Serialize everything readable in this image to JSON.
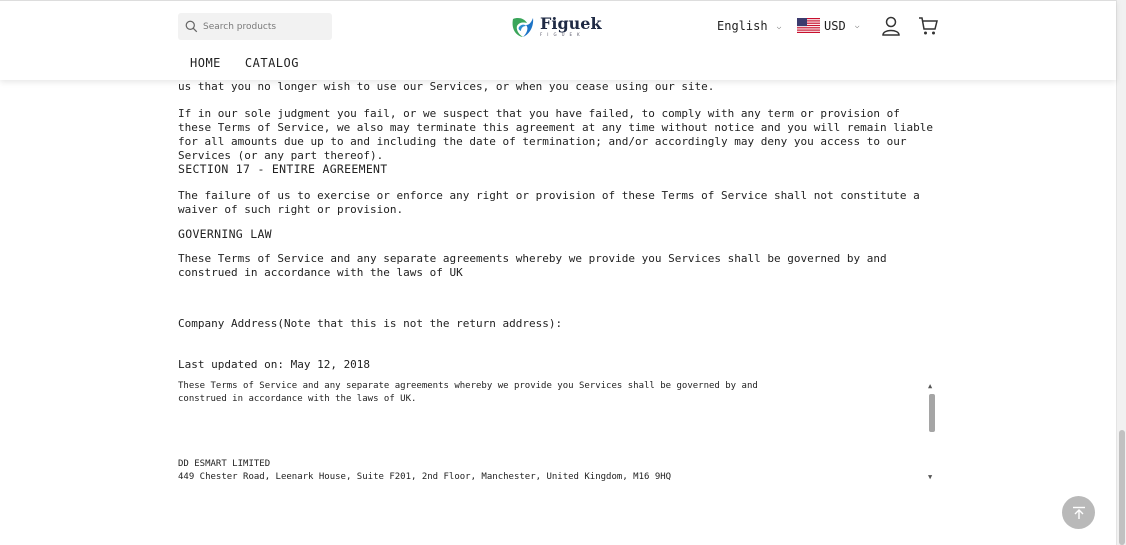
{
  "header": {
    "search_placeholder": "Search products",
    "logo_name": "Figuek",
    "logo_sub": "FIGUEK",
    "language": "English",
    "currency": "USD",
    "nav": [
      "HOME",
      "CATALOG"
    ]
  },
  "content": {
    "p_cont": "us that you no longer wish to use our Services, or when you cease using our site.",
    "p_judgment": "If in our sole judgment you fail, or we suspect that you have failed, to comply with any term or provision of these Terms of Service, we also may terminate this agreement at any time without notice and you will remain liable for all amounts due up to and including the date of termination; and/or accordingly may deny you access to our Services (or any part thereof).",
    "section17": "SECTION 17 - ENTIRE AGREEMENT",
    "p_failure": "The failure of us to exercise or enforce any right or provision of these Terms of Service shall not constitute a waiver of such right or provision.",
    "governing": "GOVERNING LAW",
    "p_governed": "These Terms of Service and any separate agreements whereby we provide you Services shall be governed by and construed in accordance with the laws of UK",
    "company_address": "Company Address(Note that this is not the return address):",
    "last_updated": "Last updated on: May 12, 2018",
    "box_text": "These Terms of Service and any separate agreements whereby we provide you Services shall be governed by and\nconstrued in accordance with the laws of UK.\n\n\n\n\nDD ESMART LIMITED\n449 Chester Road, Leenark House, Suite F201, 2nd Floor, Manchester, United Kingdom, M16 9HQ"
  },
  "colors": {
    "logo_green": "#3aa55a",
    "logo_blue": "#1d74c6",
    "back_top_bg": "#b9b9b9"
  }
}
